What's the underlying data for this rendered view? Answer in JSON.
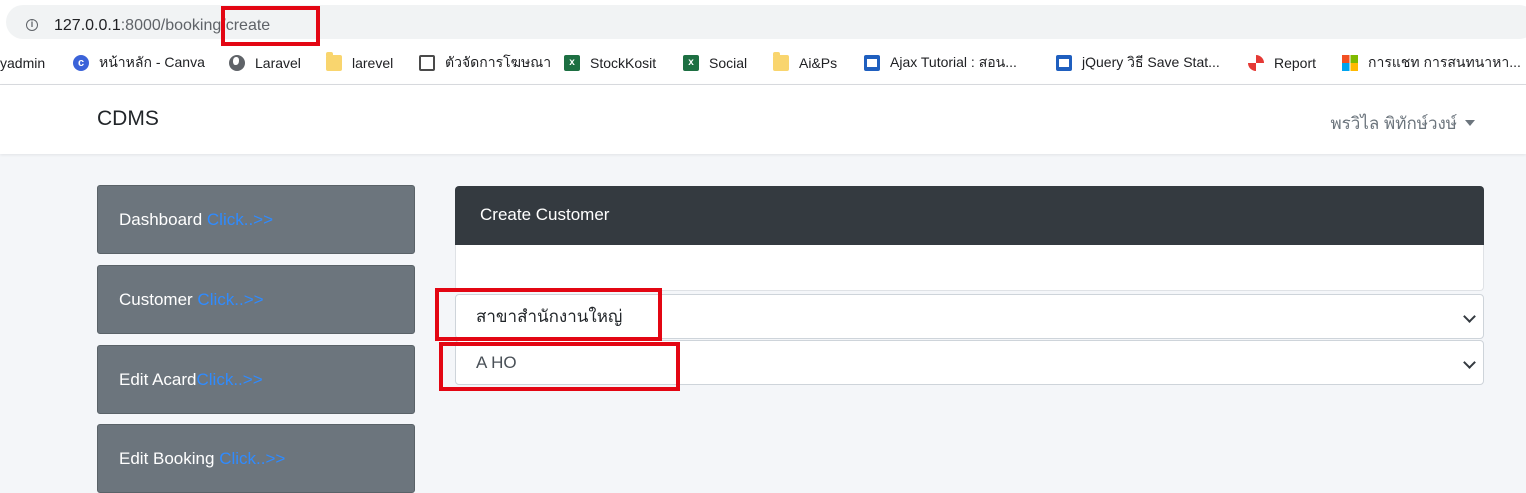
{
  "browser": {
    "url_host": "127.0.0.1",
    "url_port_path": ":8000/booking/create"
  },
  "bookmarks": [
    {
      "label": "yadmin",
      "icon": "none"
    },
    {
      "label": "หน้าหลัก - Canva",
      "icon": "canva-icon"
    },
    {
      "label": "Laravel",
      "icon": "globe-icon"
    },
    {
      "label": "larevel",
      "icon": "folder-icon"
    },
    {
      "label": "ตัวจัดการโฆษณา",
      "icon": "ad-manager-icon"
    },
    {
      "label": "StockKosit",
      "icon": "excel-icon"
    },
    {
      "label": "Social",
      "icon": "excel-icon"
    },
    {
      "label": "Ai&Ps",
      "icon": "folder-icon"
    },
    {
      "label": "Ajax Tutorial : สอน...",
      "icon": "page-icon"
    },
    {
      "label": "jQuery วิธี Save Stat...",
      "icon": "page-icon"
    },
    {
      "label": "Report",
      "icon": "report-icon"
    },
    {
      "label": "การแชท การสนทนาหา...",
      "icon": "microsoft-icon"
    }
  ],
  "header": {
    "brand": "CDMS",
    "user_name": "พรวิไล พิทักษ์วงษ์"
  },
  "sidebar": {
    "items": [
      {
        "label": "Dashboard",
        "link": "Click..>>"
      },
      {
        "label": "Customer",
        "link": "Click..>>"
      },
      {
        "label": "Edit Acard",
        "link": "Click..>>"
      },
      {
        "label": "Edit Booking",
        "link": "Click..>>"
      }
    ]
  },
  "card": {
    "title": "Create Customer"
  },
  "form": {
    "branch_select": "สาขาสำนักงานใหญ่",
    "code_select": "A HO"
  },
  "colors": {
    "highlight": "#e30613",
    "sidebar_bg": "#6c757d",
    "card_header_bg": "#343a40",
    "link": "#2f8bff"
  }
}
